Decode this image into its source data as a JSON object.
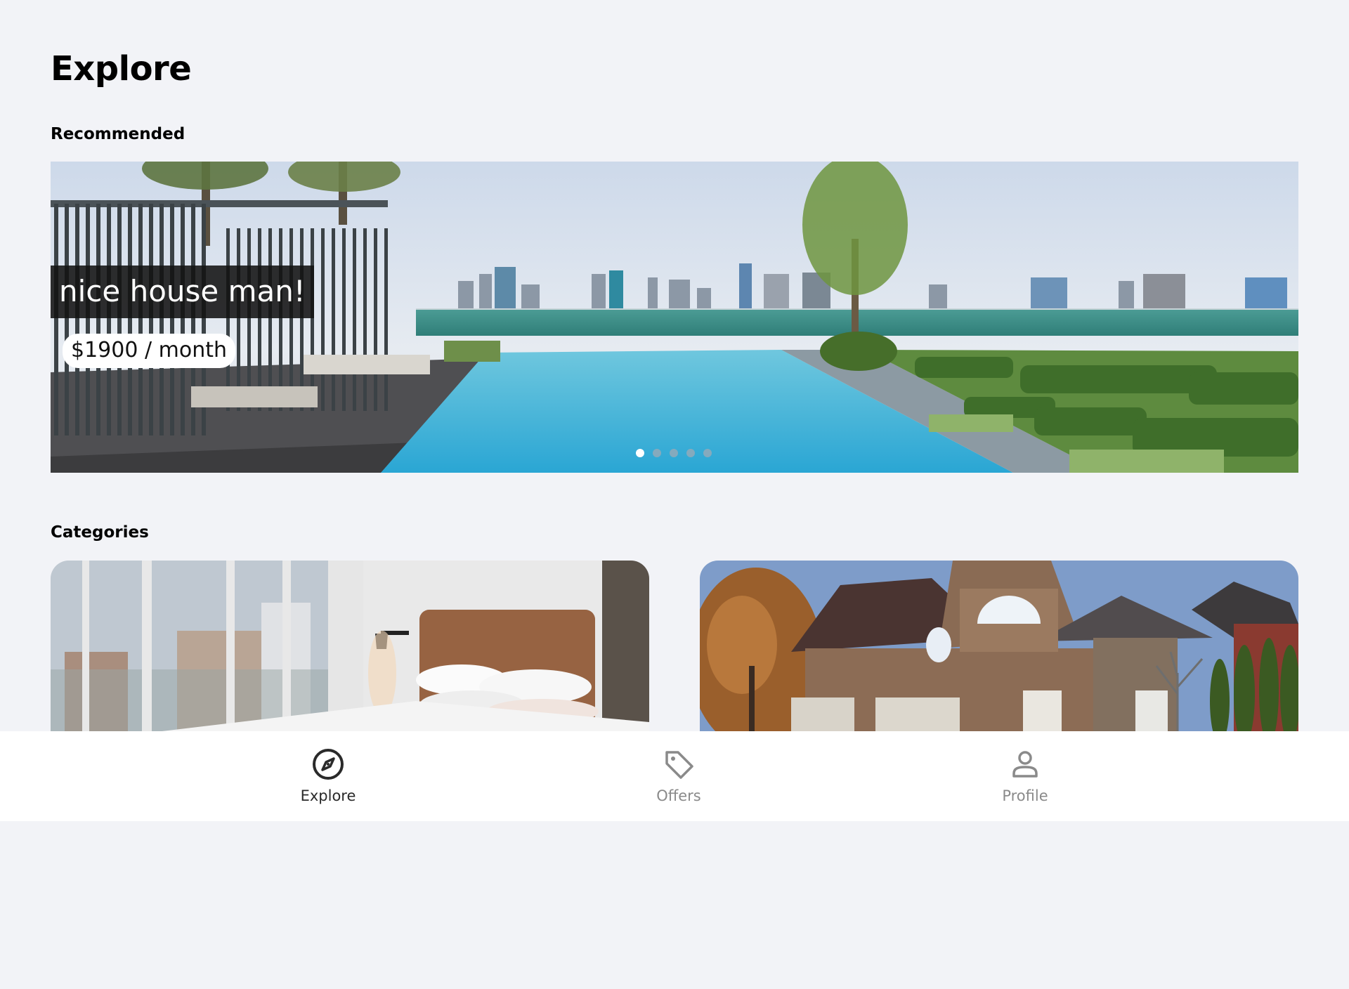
{
  "page": {
    "title": "Explore"
  },
  "sections": {
    "recommended": "Recommended",
    "categories": "Categories"
  },
  "hero": {
    "caption": "nice house man!",
    "price": "$1900 / month",
    "slides": 5,
    "active_slide": 1
  },
  "categories": [
    {
      "image": "bedroom-photo"
    },
    {
      "image": "house-exterior-photo"
    }
  ],
  "nav": {
    "items": [
      {
        "label": "Explore",
        "icon": "compass-icon",
        "active": true
      },
      {
        "label": "Offers",
        "icon": "tag-icon",
        "active": false
      },
      {
        "label": "Profile",
        "icon": "user-icon",
        "active": false
      }
    ]
  },
  "colors": {
    "background": "#f2f3f7",
    "active_nav": "#2a2a2a",
    "inactive_nav": "#8a8a8a",
    "caption_bg": "#121212"
  }
}
